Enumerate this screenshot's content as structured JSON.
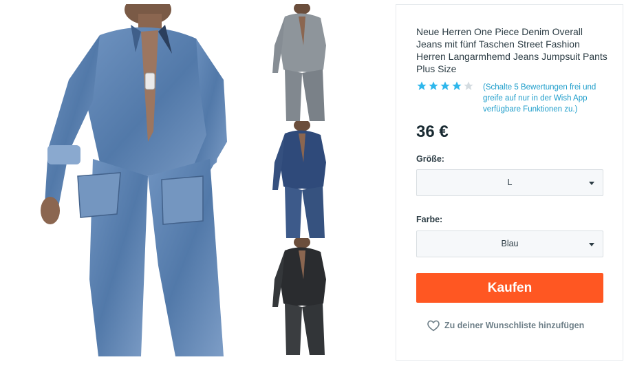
{
  "product": {
    "title": "Neue Herren One Piece Denim Overall Jeans mit fünf Taschen Street Fashion Herren Langarmhemd Jeans Jumpsuit Pants Plus Size",
    "rating": {
      "stars": 4,
      "max_stars": 5,
      "note": "(Schalte 5 Bewertungen frei und greife auf nur in der Wish App verfügbare Funktionen zu.)"
    },
    "price": "36 €",
    "size": {
      "label": "Größe:",
      "value": "L"
    },
    "color": {
      "label": "Farbe:",
      "value": "Blau"
    },
    "buy_label": "Kaufen",
    "wishlist_label": "Zu deiner Wunschliste hinzufügen"
  },
  "gallery": {
    "main_image": "man-in-light-blue-denim-jumpsuit",
    "thumbnails": [
      "grey-denim-jumpsuit",
      "dark-blue-denim-jumpsuit",
      "black-denim-jumpsuit"
    ]
  },
  "colors": {
    "accent_orange": "#ff5722",
    "link_blue": "#1b9cca",
    "star_active": "#2fb7ec",
    "star_inactive": "#d3dbe0"
  }
}
